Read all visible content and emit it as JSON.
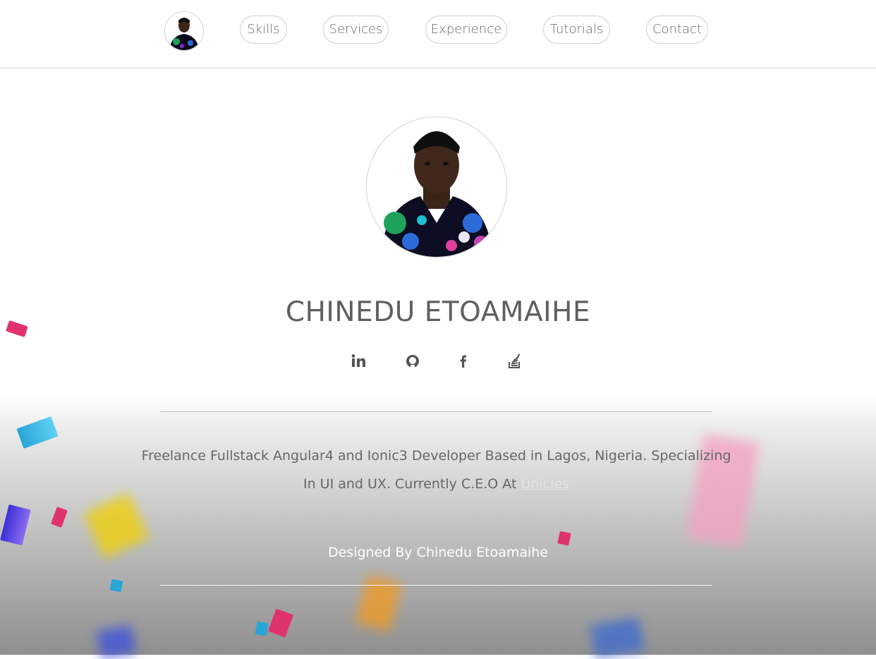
{
  "nav": {
    "links": [
      {
        "label": "Skills"
      },
      {
        "label": "Services"
      },
      {
        "label": "Experience"
      },
      {
        "label": "Tutorials"
      },
      {
        "label": "Contact"
      }
    ]
  },
  "profile": {
    "name": "CHINEDU ETOAMAIHE",
    "bio_text": "Freelance Fullstack Angular4 and Ionic3 Developer Based in Lagos, Nigeria. Specializing In UI and UX. Currently C.E.O At",
    "company_link": "Unicles"
  },
  "social": [
    {
      "icon": "linkedin-icon"
    },
    {
      "icon": "github-icon"
    },
    {
      "icon": "facebook-icon"
    },
    {
      "icon": "stackoverflow-icon"
    }
  ],
  "footer": {
    "credit": "Designed By Chinedu Etoamaihe"
  },
  "colors": {
    "text": "#5f5f5f",
    "border": "#cfcfcf",
    "accent_confetti": [
      "#e0336e",
      "#29a5d8",
      "#3b2fd6",
      "#f0d000",
      "#f39a1e"
    ]
  }
}
